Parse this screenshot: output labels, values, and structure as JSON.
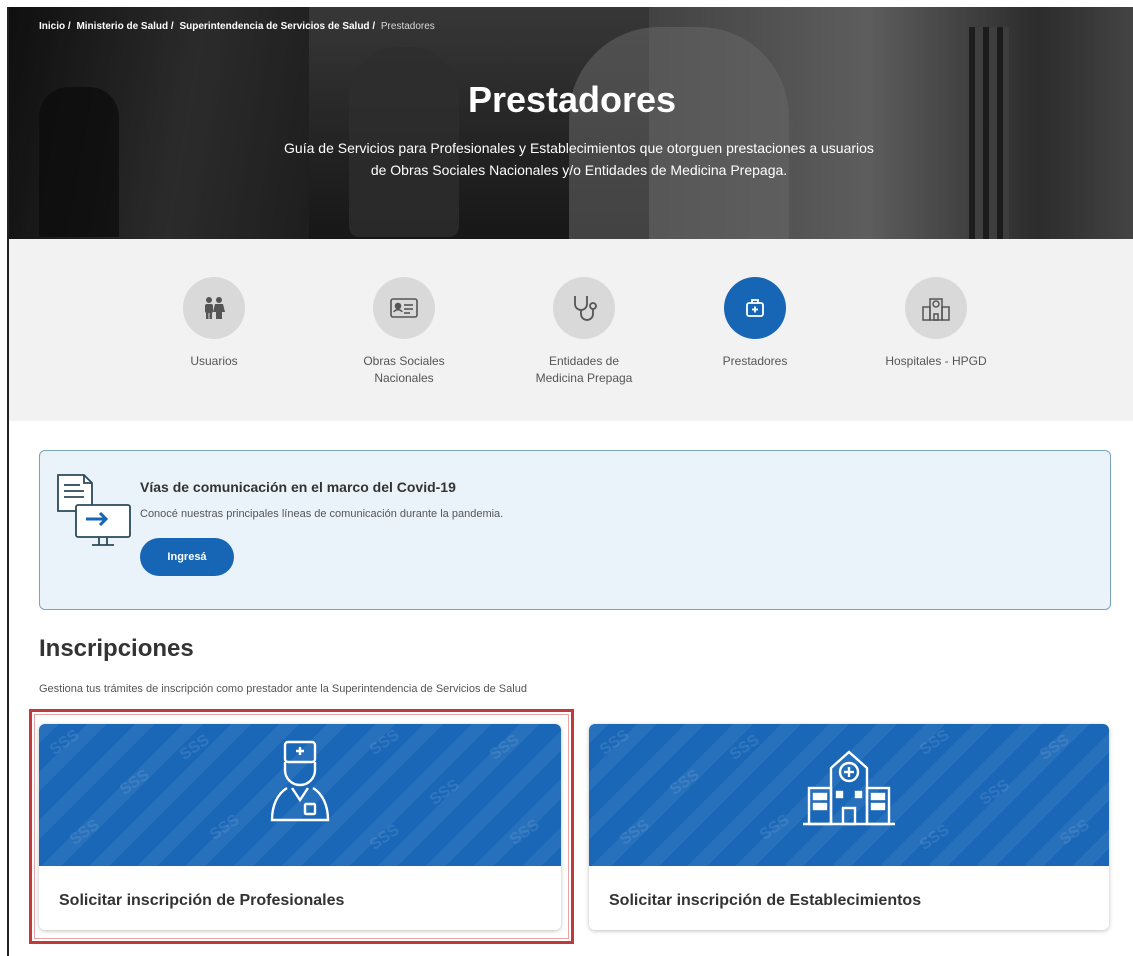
{
  "breadcrumb": {
    "items": [
      "Inicio /",
      "Ministerio de Salud /",
      "Superintendencia de Servicios de Salud /"
    ],
    "current": "Prestadores"
  },
  "hero": {
    "title": "Prestadores",
    "subtitle_line1": "Guía de Servicios para Profesionales y Establecimientos que otorguen prestaciones a usuarios",
    "subtitle_line2": "de Obras Sociales Nacionales y/o Entidades de Medicina Prepaga."
  },
  "nav": {
    "items": [
      {
        "label": "Usuarios",
        "icon": "users-icon",
        "active": false
      },
      {
        "label": "Obras Sociales Nacionales",
        "icon": "id-card-icon",
        "active": false
      },
      {
        "label": "Entidades de Medicina Prepaga",
        "icon": "stethoscope-icon",
        "active": false
      },
      {
        "label": "Prestadores",
        "icon": "medical-kit-icon",
        "active": true
      },
      {
        "label": "Hospitales - HPGD",
        "icon": "hospital-icon",
        "active": false
      }
    ],
    "active_color": "#1766b5",
    "inactive_color": "#d9d9d9"
  },
  "alert": {
    "title": "Vías de comunicación en el marco del Covid-19",
    "text": "Conocé nuestras principales líneas de comunicación durante la pandemia.",
    "button": "Ingresá",
    "icon": "document-monitor-icon"
  },
  "inscripciones": {
    "title": "Inscripciones",
    "description": "Gestiona tus trámites de inscripción como prestador ante la Superintendencia de Servicios de Salud",
    "cards": [
      {
        "label": "Solicitar inscripción de Profesionales",
        "icon": "nurse-icon",
        "highlighted": true
      },
      {
        "label": "Solicitar inscripción de Establecimientos",
        "icon": "hospital-building-icon",
        "highlighted": false
      }
    ],
    "watermark_text": "SSS",
    "card_color": "#1a67b7",
    "highlight_color": "#c0393b"
  }
}
